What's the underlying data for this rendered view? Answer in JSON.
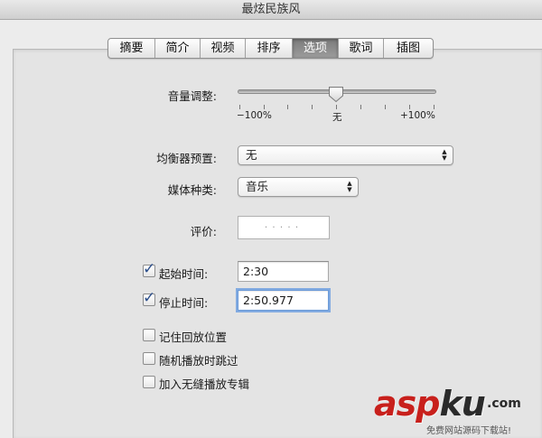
{
  "window": {
    "title": "最炫民族风"
  },
  "tabs": [
    {
      "label": "摘要",
      "active": false
    },
    {
      "label": "简介",
      "active": false
    },
    {
      "label": "视频",
      "active": false
    },
    {
      "label": "排序",
      "active": false
    },
    {
      "label": "选项",
      "active": true
    },
    {
      "label": "歌词",
      "active": false
    },
    {
      "label": "插图",
      "active": false
    }
  ],
  "volume": {
    "label": "音量调整:",
    "value_percent": 0,
    "min_label": "−100%",
    "mid_label": "无",
    "max_label": "+100%"
  },
  "equalizer": {
    "label": "均衡器预置:",
    "value": "无"
  },
  "media_kind": {
    "label": "媒体种类:",
    "value": "音乐"
  },
  "rating": {
    "label": "评价:",
    "dots": "·····",
    "stars": 0
  },
  "start_time": {
    "label": "起始时间:",
    "checked": true,
    "value": "2:30"
  },
  "stop_time": {
    "label": "停止时间:",
    "checked": true,
    "value": "2:50.977"
  },
  "options": [
    {
      "label": "记住回放位置",
      "checked": false
    },
    {
      "label": "随机播放时跳过",
      "checked": false
    },
    {
      "label": "加入无缝播放专辑",
      "checked": false
    }
  ],
  "watermark": {
    "brand_asp": "asp",
    "brand_ku": "ku",
    "brand_com": ".com",
    "subtitle": "免费网站源码下载站!"
  },
  "colors": {
    "focus_ring": "#6198e0",
    "checkmark": "#2c4f8c",
    "watermark_red": "#c8201c"
  }
}
